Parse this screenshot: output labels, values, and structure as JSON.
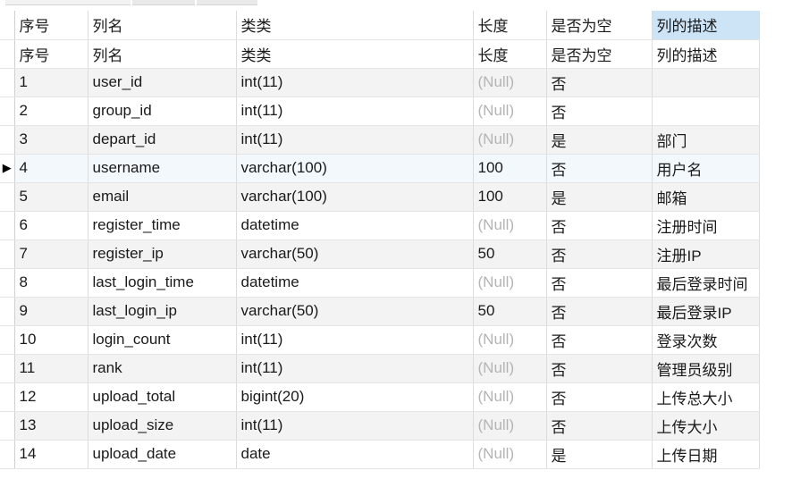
{
  "header_row": [
    "序号",
    "列名",
    "类类",
    "长度",
    "是否为空",
    "列的描述"
  ],
  "rows": [
    [
      "序号",
      "列名",
      "类类",
      "长度",
      "是否为空",
      "列的描述"
    ],
    [
      "1",
      "user_id",
      "int(11)",
      "(Null)",
      "否",
      ""
    ],
    [
      "2",
      "group_id",
      "int(11)",
      "(Null)",
      "否",
      ""
    ],
    [
      "3",
      "depart_id",
      "int(11)",
      "(Null)",
      "是",
      "部门"
    ],
    [
      "4",
      "username",
      "varchar(100)",
      "100",
      "否",
      "用户名"
    ],
    [
      "5",
      "email",
      "varchar(100)",
      "100",
      "是",
      "邮箱"
    ],
    [
      "6",
      "register_time",
      "datetime",
      "(Null)",
      "否",
      "注册时间"
    ],
    [
      "7",
      "register_ip",
      "varchar(50)",
      "50",
      "否",
      "注册IP"
    ],
    [
      "8",
      "last_login_time",
      "datetime",
      "(Null)",
      "否",
      "最后登录时间"
    ],
    [
      "9",
      "last_login_ip",
      "varchar(50)",
      "50",
      "否",
      "最后登录IP"
    ],
    [
      "10",
      "login_count",
      "int(11)",
      "(Null)",
      "否",
      "登录次数"
    ],
    [
      "11",
      "rank",
      "int(11)",
      "(Null)",
      "否",
      "管理员级别"
    ],
    [
      "12",
      "upload_total",
      "bigint(20)",
      "(Null)",
      "否",
      "上传总大小"
    ],
    [
      "13",
      "upload_size",
      "int(11)",
      "(Null)",
      "否",
      "上传大小"
    ],
    [
      "14",
      "upload_date",
      "date",
      "(Null)",
      "是",
      "上传日期"
    ]
  ],
  "current_row_indicator": "▶",
  "current_row_index": 4,
  "null_text": "(Null)",
  "colors": {
    "selected_cell_bg": "#cde4f7",
    "null_text": "#b4b4b4",
    "alt_row_bg": "#f3f3f3"
  }
}
